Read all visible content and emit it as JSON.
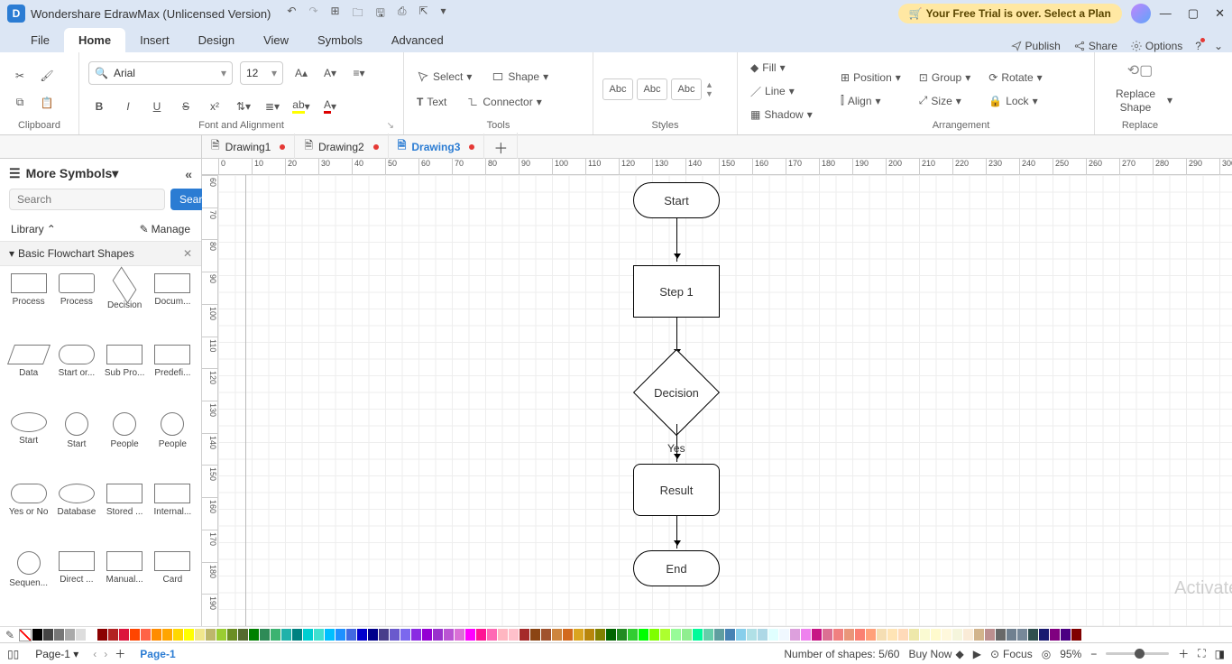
{
  "titlebar": {
    "app_title": "Wondershare EdrawMax (Unlicensed Version)",
    "trial_text": "Your Free Trial is over. Select a Plan"
  },
  "menu": {
    "tabs": [
      "File",
      "Home",
      "Insert",
      "Design",
      "View",
      "Symbols",
      "Advanced"
    ],
    "right": {
      "publish": "Publish",
      "share": "Share",
      "options": "Options"
    }
  },
  "ribbon": {
    "clipboard_label": "Clipboard",
    "font_name": "Arial",
    "font_size": "12",
    "font_label": "Font and Alignment",
    "select": "Select",
    "shape": "Shape",
    "text": "Text",
    "connector": "Connector",
    "tools_label": "Tools",
    "style_abc": "Abc",
    "styles_label": "Styles",
    "fill": "Fill",
    "line": "Line",
    "shadow": "Shadow",
    "position": "Position",
    "align": "Align",
    "group": "Group",
    "size": "Size",
    "rotate": "Rotate",
    "lock": "Lock",
    "arrangement_label": "Arrangement",
    "replace_shape": "Replace Shape",
    "replace_label": "Replace"
  },
  "doctabs": [
    {
      "name": "Drawing1",
      "dirty": true,
      "active": false
    },
    {
      "name": "Drawing2",
      "dirty": true,
      "active": false
    },
    {
      "name": "Drawing3",
      "dirty": true,
      "active": true
    }
  ],
  "sidebar": {
    "more": "More Symbols",
    "search_placeholder": "Search",
    "search_btn": "Search",
    "library": "Library",
    "manage": "Manage",
    "category": "Basic Flowchart Shapes",
    "shapes": [
      "Process",
      "Process",
      "Decision",
      "Docum...",
      "Data",
      "Start or...",
      "Sub Pro...",
      "Predefi...",
      "Start",
      "Start",
      "People",
      "People",
      "Yes or No",
      "Database",
      "Stored ...",
      "Internal...",
      "Sequen...",
      "Direct ...",
      "Manual...",
      "Card"
    ]
  },
  "flowchart": {
    "start": "Start",
    "step1": "Step 1",
    "decision": "Decision",
    "yes": "Yes",
    "result": "Result",
    "end": "End"
  },
  "colorstrip": [
    "#000",
    "#444",
    "#777",
    "#aaa",
    "#ddd",
    "#fff",
    "#8b0000",
    "#b22222",
    "#dc143c",
    "#ff4500",
    "#ff6347",
    "#ff8c00",
    "#ffa500",
    "#ffd700",
    "#ffff00",
    "#f0e68c",
    "#bdb76b",
    "#9acd32",
    "#6b8e23",
    "#556b2f",
    "#008000",
    "#2e8b57",
    "#3cb371",
    "#20b2aa",
    "#008080",
    "#00ced1",
    "#40e0d0",
    "#00bfff",
    "#1e90ff",
    "#4169e1",
    "#0000cd",
    "#00008b",
    "#483d8b",
    "#6a5acd",
    "#7b68ee",
    "#8a2be2",
    "#9400d3",
    "#9932cc",
    "#ba55d3",
    "#da70d6",
    "#ff00ff",
    "#ff1493",
    "#ff69b4",
    "#ffb6c1",
    "#ffc0cb",
    "#a52a2a",
    "#8b4513",
    "#a0522d",
    "#cd853f",
    "#d2691e",
    "#daa520",
    "#b8860b",
    "#808000",
    "#006400",
    "#228b22",
    "#32cd32",
    "#00ff00",
    "#7fff00",
    "#adff2f",
    "#98fb98",
    "#90ee90",
    "#00fa9a",
    "#66cdaa",
    "#5f9ea0",
    "#4682b4",
    "#87ceeb",
    "#b0e0e6",
    "#add8e6",
    "#e0ffff",
    "#f0f8ff",
    "#dda0dd",
    "#ee82ee",
    "#c71585",
    "#db7093",
    "#f08080",
    "#e9967a",
    "#fa8072",
    "#ffa07a",
    "#f5deb3",
    "#ffe4b5",
    "#ffdab9",
    "#eee8aa",
    "#fafad2",
    "#fffacd",
    "#fff8dc",
    "#f5f5dc",
    "#faebd7",
    "#d2b48c",
    "#bc8f8f",
    "#696969",
    "#708090",
    "#778899",
    "#2f4f4f",
    "#191970",
    "#800080",
    "#4b0082",
    "#800000"
  ],
  "ruler": {
    "h_start": 0,
    "h_step": 10,
    "h_count": 34,
    "v_start": 60,
    "v_step": 10,
    "v_count": 14
  },
  "status": {
    "page": "Page-1",
    "page_active": "Page-1",
    "shapes": "Number of shapes: 5/60",
    "buy": "Buy Now",
    "focus": "Focus",
    "zoom": "95%"
  },
  "watermark": "Activate Windows"
}
